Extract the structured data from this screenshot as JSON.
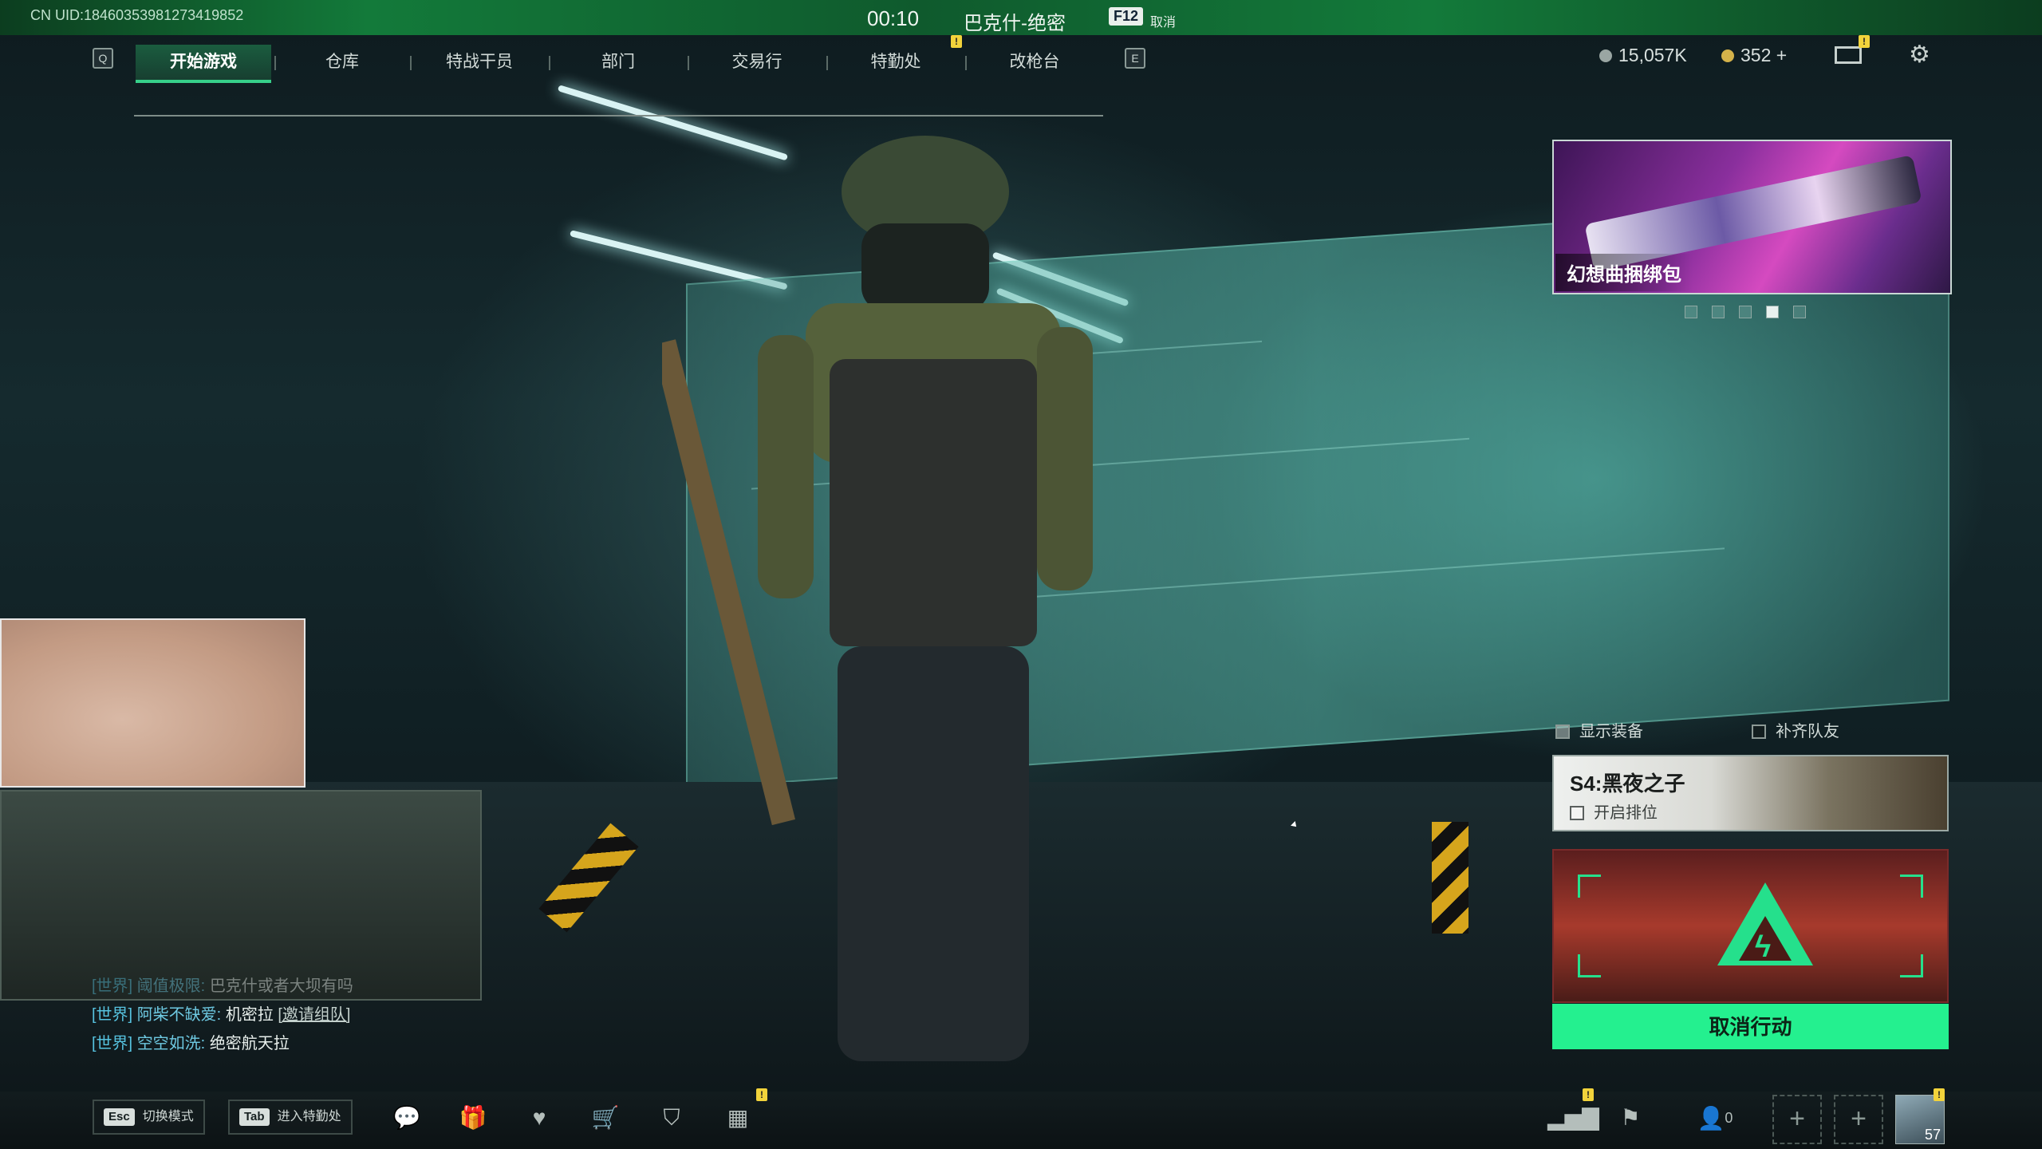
{
  "top_status": {
    "uid": "CN UID:1846035398127341985​2",
    "timer": "00:10",
    "match": "巴克什-绝密",
    "cancel_key": "F12",
    "cancel_label": "取消"
  },
  "nav": {
    "left_key": "Q",
    "right_key": "E",
    "tabs": [
      {
        "label": "开始游戏"
      },
      {
        "label": "仓库"
      },
      {
        "label": "特战干员"
      },
      {
        "label": "部门"
      },
      {
        "label": "交易行"
      },
      {
        "label": "特勤处"
      },
      {
        "label": "改枪台"
      }
    ],
    "alert_mark": "!"
  },
  "currency": {
    "primary": "15,057K",
    "secondary": "352 +"
  },
  "promo": {
    "label": "幻想曲捆绑包",
    "dots": 5,
    "active_dot": 3
  },
  "options": {
    "show_gear": "显示装备",
    "fill_team": "补齐队友"
  },
  "season": {
    "title": "S4:黑夜之子",
    "ranked": "开启排位"
  },
  "action": {
    "button": "取消行动"
  },
  "chat": [
    {
      "channel": "[世界]",
      "name": "阈值极限:",
      "msg": "巴克什或者大坝有吗",
      "invite": ""
    },
    {
      "channel": "[世界]",
      "name": "阿柴不缺爱:",
      "msg": "机密拉",
      "invite": "[邀请组队]"
    },
    {
      "channel": "[世界]",
      "name": "空空如洗:",
      "msg": "绝密航天拉",
      "invite": ""
    }
  ],
  "bottom": {
    "esc_key": "Esc",
    "esc_label": "切换模式",
    "tab_key": "Tab",
    "tab_label": "进入特勤处",
    "friends_count": "0",
    "player_level": "57",
    "slot_plus": "+"
  },
  "icons": {
    "bottom_left": [
      "chat-icon",
      "gift-icon",
      "shield-heart-icon",
      "shop-cart-icon",
      "badge-icon",
      "calendar-icon"
    ],
    "bottom_right": [
      "stats-icon",
      "flag-icon",
      "friends-icon"
    ]
  },
  "colors": {
    "accent": "#24f08f",
    "topbar": "#137a3a",
    "warning": "#f2d33b",
    "chat_channel": "#56c2df"
  }
}
